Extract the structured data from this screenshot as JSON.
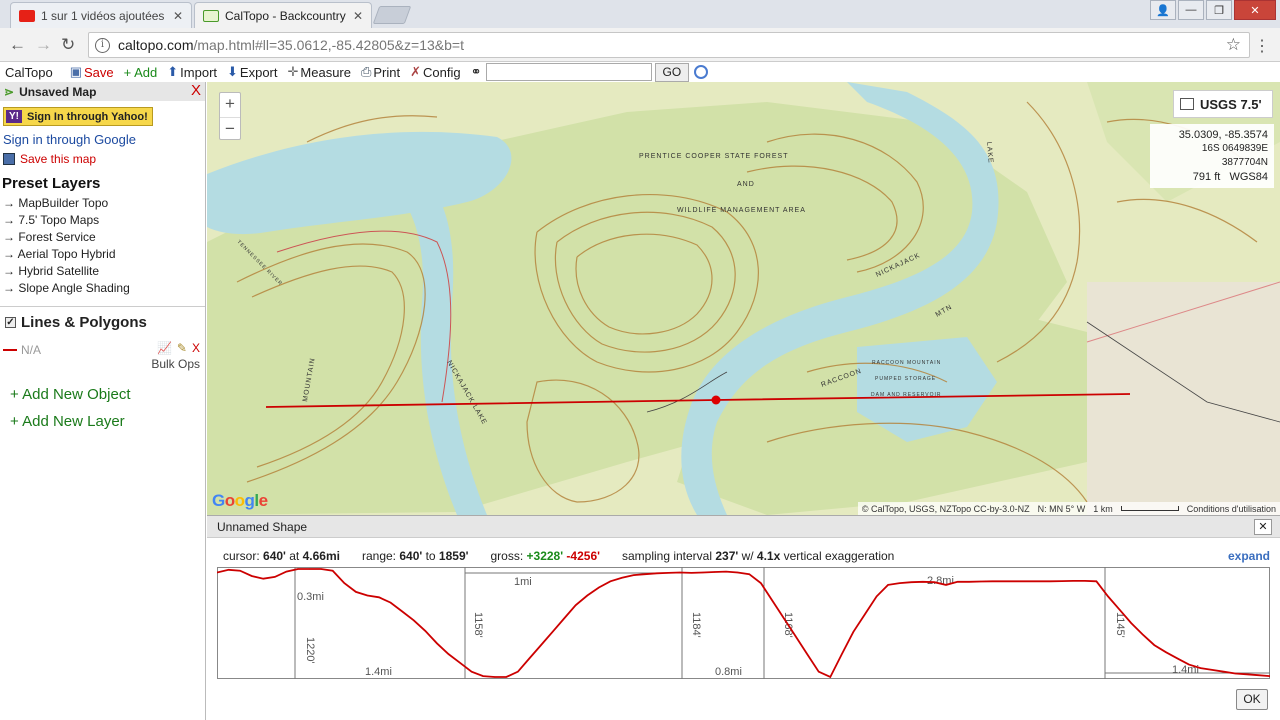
{
  "browser": {
    "tabs": [
      {
        "title": "1 sur 1 vidéos ajoutées -",
        "favicon_color": "#e62117"
      },
      {
        "title": "CalTopo - Backcountry M",
        "favicon_color": "#4a9a2a"
      }
    ],
    "url_host": "caltopo.com",
    "url_rest": "/map.html#ll=35.0612,-85.42805&z=13&b=t"
  },
  "toolbar": {
    "brand": "CalTopo",
    "save": "Save",
    "add": "+ Add",
    "import": "Import",
    "export": "Export",
    "measure": "Measure",
    "print": "Print",
    "config": "Config",
    "go": "GO"
  },
  "sidebar": {
    "header": "Unsaved Map",
    "close": "X",
    "yahoo": "Sign In through Yahoo!",
    "yahoo_badge": "Y!",
    "google": "Sign in through Google",
    "save_map": "Save this map",
    "preset_title": "Preset Layers",
    "presets": [
      "→ MapBuilder Topo",
      "→ 7.5' Topo Maps",
      "→ Forest Service",
      "→ Aerial Topo Hybrid",
      "→ Hybrid Satellite",
      "→ Slope Angle Shading"
    ],
    "lines_title": "Lines & Polygons",
    "object_name": "N/A",
    "object_delete": "X",
    "bulk_ops": "Bulk Ops",
    "add_object": "+ Add New Object",
    "add_layer": "+ Add New Layer"
  },
  "map": {
    "zoom_in": "+",
    "zoom_out": "−",
    "layer": "USGS 7.5'",
    "coords": {
      "latlng": "35.0309, -85.3574",
      "utm": "16S 0649839E 3877704N",
      "elev": "791 ft",
      "datum": "WGS84"
    },
    "google": "Google",
    "attribution": "© CalTopo, USGS, NZTopo CC-by-3.0-NZ",
    "declination": "N: MN 5° W",
    "scale": "1 km",
    "terms": "Conditions d'utilisation",
    "labels": [
      "PRENTICE COOPER STATE FOREST",
      "AND",
      "WILDLIFE MANAGEMENT AREA",
      "NICKAJACK LAKE",
      "NICKAJACK",
      "RACCOON MOUNTAIN",
      "PUMPED STORAGE",
      "DAM AND RESERVOIR",
      "RACCOON",
      "MTN",
      "MOUNTAIN",
      "TENNESSEE RIVER",
      "LAKE"
    ],
    "colors": {
      "paper": "#e5eac0",
      "forest": "#cfdfa6",
      "water": "#b4dce2",
      "contour": "#b5853e",
      "route": "#cc0000"
    }
  },
  "profile": {
    "title": "Unnamed Shape",
    "close": "✕",
    "cursor_label": "cursor:",
    "cursor_elev": "640'",
    "cursor_at": "at",
    "cursor_dist": "4.66mi",
    "range_label": "range:",
    "range_min": "640'",
    "range_to": "to",
    "range_max": "1859'",
    "gross_label": "gross:",
    "gross_up": "+3228'",
    "gross_down": "-4256'",
    "sampling_label": "sampling interval",
    "sampling_value": "237'",
    "sampling_w": "w/",
    "vert_value": "4.1x",
    "vert_label": "vertical exaggeration",
    "expand": "expand",
    "ok": "OK",
    "segment_labels": [
      "0.3mi",
      "1.4mi",
      "1mi",
      "0.8mi",
      "2.8mi",
      "1.4mi"
    ],
    "segment_vertical_labels": [
      "1220'",
      "1158'",
      "1184'",
      "1168'",
      "1145'"
    ]
  },
  "chart_data": {
    "type": "line",
    "title": "",
    "xlabel": "",
    "ylabel": "",
    "ylim": [
      640,
      1859
    ],
    "series": [
      {
        "values": [
          1820,
          1850,
          1840,
          1780,
          1750,
          1770,
          1830,
          1859,
          1859,
          1859,
          1840,
          1700,
          1600,
          1560,
          1540,
          1480,
          1380,
          1280,
          1160,
          1020,
          900,
          800,
          700,
          650,
          640,
          640,
          700,
          850,
          1000,
          1150,
          1300,
          1450,
          1560,
          1650,
          1720,
          1760,
          1790,
          1800,
          1810,
          1815,
          1820,
          1815,
          1820,
          1825,
          1830,
          1820,
          1800,
          1700,
          1500,
          1300,
          1100,
          900,
          700,
          640,
          900,
          1150,
          1350,
          1550,
          1680,
          1700,
          1710,
          1715,
          1710,
          1680,
          1715,
          1715,
          1718,
          1720,
          1720,
          1720,
          1720,
          1720,
          1720,
          1722,
          1725,
          1725,
          1720,
          1550,
          1400,
          1250,
          1120,
          1000,
          920,
          850,
          780,
          740,
          720,
          700,
          680,
          670,
          660,
          650
        ]
      }
    ]
  }
}
